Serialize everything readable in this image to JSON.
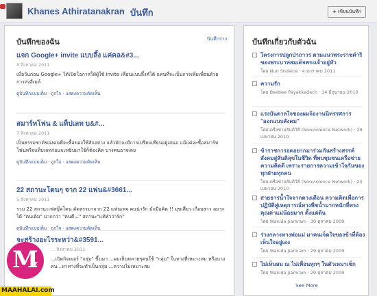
{
  "header": {
    "profile_name": "Khanes Athiratanakran",
    "breadcrumb_separator": "▸",
    "section_title": "บันทึก",
    "write_button": {
      "icon": "+",
      "label": "เขียนบันทึก"
    }
  },
  "my_notes": {
    "heading": "บันทึกของฉัน",
    "link": "บันทึกร่าง",
    "items": [
      {
        "title": "แจก Google+ invite แบบลึ้ง แค่คล&#3...",
        "date": "8 สิงหาคม 2011",
        "excerpt": "เมื่อวันก่อน Google+ ได้เปิดโอกาสให้ผู้ใช้ invite เพื่อนแบบลึ้งค์ได้ แทนที่จะเป็นการเพิ่มเพื่อนด้วยการส่งอีเมล์",
        "actions": "ดูบันทึกแบบเต็ม · ถูกใจ · แสดงความคิดเห็น"
      },
      {
        "title": "สมาร์ทโฟน & แท็ปเลท บ&#...",
        "date": "7 สิงหาคม 2011",
        "excerpt": "เป็นธรรมชาติของคนที่จะซื้อของใช้สักอย่าง แล้วมักจะมีการเปรียบเทียบอยู่เสมอ แม้แต่จะซื้อสมาร์ทโฟนหรือแท็บเลทก่อนจะหยิบมาใช้ก็ต้องคิด บางคนอาจเลย",
        "actions": "ดูบันทึกแบบเต็ม · ถูกใจ · แสดงความคิดเห็น"
      },
      {
        "title": "22 สถานะโดนๆ จาก 22 แฟน&#3661...",
        "date": "5 สิงหาคม 2011",
        "excerpt": "รวม 22 สถานะเฟสบุ๊คโดน คัดสรรมาจาก 22 แฟนเพจ คนน่ารัก มักมีอคิต !! มุขเสี่ยว เกือบสาว อยากได้ \"คนเดิม\" มากกว่า \"คนดี...\" สถานะ\"แท้ทำว่ารัก\"",
        "actions": "ดูบันทึกแบบเต็ม · ถูกใจ · แสดงความคิดเห็น"
      },
      {
        "title": "จะสร้างอะไรระหว่า&#3591...",
        "date": "... สิงหาคม 2011",
        "excerpt": "...เปิดกิจเยอร์ \"กลุ่ม\" ขึ้นมา ...ผมเห็นหลายๆคนใช้ \"กลุ่ม\" ในทางที่เหมาะสม หรือบางคน...หาทางที่จะทำเป็นกลุ่ม ...ความไม่เหมาะสม",
        "actions": ""
      }
    ]
  },
  "about_me": {
    "heading": "บันทึกเกี่ยวกับตัวฉัน",
    "see_more": "See More",
    "items": [
      {
        "title": "โครงการปลูกป่าถาวร ตามแนวพระราชดำริของพระบาทสมเด็จพระเจ้าอยู่หัว",
        "meta": "โดย Nun Sodaice · 4 มกราคม 2011"
      },
      {
        "title": "ความรัก",
        "meta": "โดย Beebee Payakkadech · 14 มิถุนายน 2010"
      },
      {
        "title": "แรงบันดาลใจของผมจ้องานนิทรรศการ \"ออกแบบสังคม\"",
        "meta": "โดยเครือข่ายสันติวิธี (Nonviolence Network) · 29 เมษายน 2010"
      },
      {
        "title": "ข้าราชการอดอยากมาร่วมกันสร้างสรรค์สังคมสู่สันติสุขในชีวิต ที่พบชุมชนเครือข่าย ความคิดดี เพราะรายการความเข้าใจกันของทุกฝ่ายทุกคน",
        "meta": "โดยเครือข่ายสันติวิธี (Nonviolence Network) · 23 เมษายน 2010"
      },
      {
        "title": "สายธารน้ำใจจากดวงเดือน ความคิดเพื่อการปฏิบัติสู่เหตุการณ์ทางพืชน้ำมากหนักที่ทรงคุณค่าแม่น้อยมาก ตั้งแต่ต้น",
        "meta": "โดย Wanida Jiamram · 30 ตุลาคม 2009"
      },
      {
        "title": "ร่วงกลางทางพ่อแม่ มาคนเจ็ดใจของข้าที่ต้องเห็นใจอยู่เอง",
        "meta": "โดย Wanida Jiamram · 29 ตุลาคม 2009"
      },
      {
        "title": "ไม่เห็นสม ณ ไม่เพื่อนทุกๆ ในตัวเหมาเช็ก",
        "meta": "โดย Wanida Jiamram · 29 ตุลาคม 2009"
      }
    ]
  },
  "watermark": {
    "letter": "M",
    "star": "★",
    "text": "MAAHALAI.com"
  }
}
